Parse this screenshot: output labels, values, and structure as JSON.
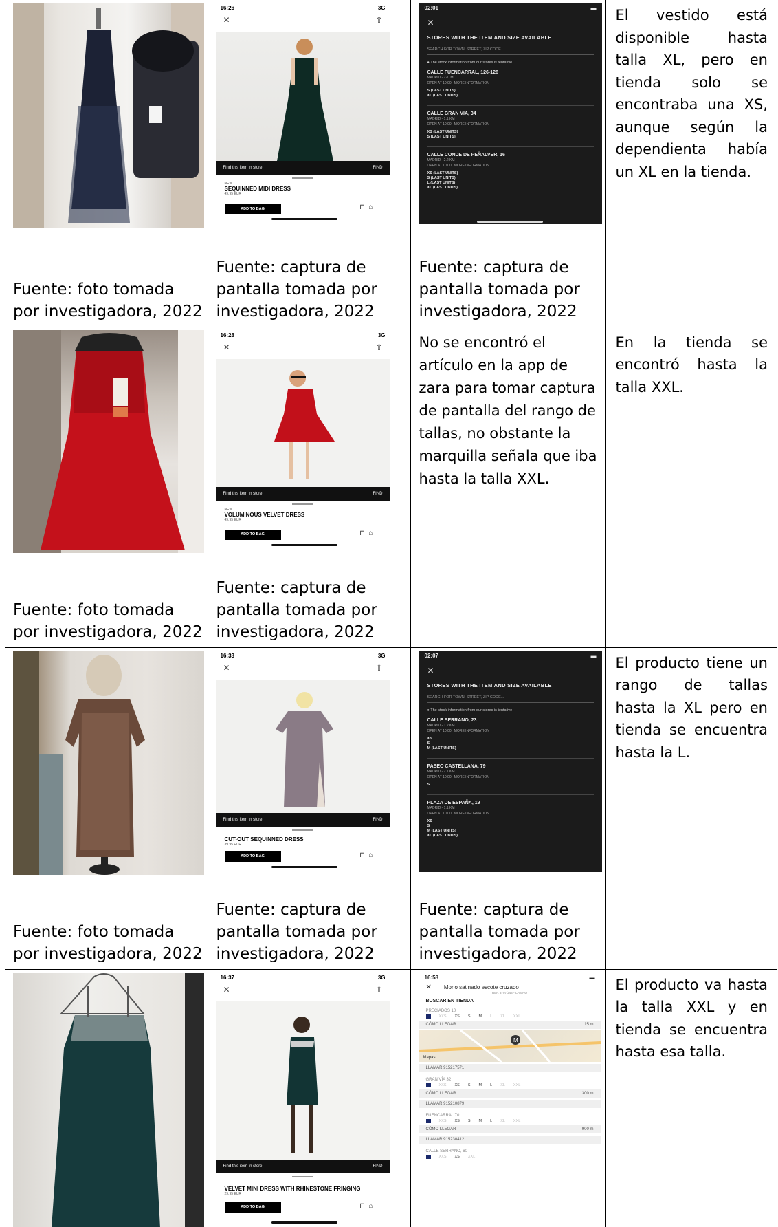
{
  "captions": {
    "photo": "Fuente: foto tomada por investigadora, 2022",
    "screenshot": "Fuente: captura de pantalla tomada por investigadora, 2022"
  },
  "rows": [
    {
      "note": "El vestido está disponible hasta talla XL, pero en tienda solo se encontraba una XS, aunque según la dependienta había un XL en la tienda.",
      "app": {
        "time": "16:26",
        "signal": "3G",
        "new_label": "NEW",
        "name": "SEQUINNED MIDI DRESS",
        "price": "49.95 EUR",
        "find_label": "Find this item in store",
        "find_action": "FIND",
        "add_label": "ADD TO BAG"
      },
      "stores_screen": {
        "time": "02:01",
        "title": "STORES WITH THE ITEM AND SIZE AVAILABLE",
        "search_placeholder": "SEARCH FOR TOWN, STREET, ZIP CODE...",
        "info": "The stock information from our stores is tentative",
        "stores": [
          {
            "name": "CALLE FUENCARRAL, 126-128",
            "city": "MADRID - 220 M",
            "open": "OPEN AT 10:00",
            "more": "MORE INFORMATION",
            "sizes": [
              "S (LAST UNITS)",
              "XL (LAST UNITS)"
            ]
          },
          {
            "name": "CALLE GRAN VIA, 34",
            "city": "MADRID - 1.1 KM",
            "open": "OPEN AT 10:00",
            "more": "MORE INFORMATION",
            "sizes": [
              "XS (LAST UNITS)",
              "S (LAST UNITS)"
            ]
          },
          {
            "name": "CALLE CONDE DE PEÑALVER, 16",
            "city": "MADRID - 2.2 KM",
            "open": "OPEN AT 10:00",
            "more": "MORE INFORMATION",
            "sizes": [
              "XS (LAST UNITS)",
              "S (LAST UNITS)",
              "L (LAST UNITS)",
              "XL (LAST UNITS)"
            ]
          }
        ]
      }
    },
    {
      "note": "En la tienda se encontró hasta la talla XXL.",
      "middle_note": "No se encontró el artículo en la app de zara para tomar captura de pantalla del rango de tallas, no obstante la marquilla señala que iba hasta la talla XXL.",
      "app": {
        "time": "16:28",
        "signal": "3G",
        "new_label": "NEW",
        "name": "VOLUMINOUS VELVET DRESS",
        "price": "49.95 EUR",
        "find_label": "Find this item in store",
        "find_action": "FIND",
        "add_label": "ADD TO BAG"
      }
    },
    {
      "note": "El producto tiene un rango de tallas hasta la XL pero en tienda se encuentra hasta la L.",
      "app": {
        "time": "16:33",
        "signal": "3G",
        "name": "CUT-OUT SEQUINNED DRESS",
        "price": "39.95 EUR",
        "find_label": "Find this item in store",
        "find_action": "FIND",
        "add_label": "ADD TO BAG"
      },
      "stores_screen": {
        "time": "02:07",
        "title": "STORES WITH THE ITEM AND SIZE AVAILABLE",
        "search_placeholder": "SEARCH FOR TOWN, STREET, ZIP CODE...",
        "info": "The stock information from our stores is tentative",
        "stores": [
          {
            "name": "CALLE SERRANO, 23",
            "city": "MADRID - 1.2 KM",
            "open": "OPEN AT 10:00",
            "more": "MORE INFORMATION",
            "sizes": [
              "XS",
              "S",
              "M (LAST UNITS)"
            ]
          },
          {
            "name": "PASEO CASTELLANA, 79",
            "city": "MADRID - 2.1 KM",
            "open": "OPEN AT 10:00",
            "more": "MORE INFORMATION",
            "sizes": [
              "S"
            ]
          },
          {
            "name": "PLAZA DE ESPAÑA, 19",
            "city": "MADRID - 1.1 KM",
            "open": "OPEN AT 10:00",
            "more": "MORE INFORMATION",
            "sizes": [
              "XS",
              "S",
              "M (LAST UNITS)",
              "XL (LAST UNITS)"
            ]
          }
        ]
      }
    },
    {
      "note": "El producto va hasta la talla XXL y en tienda se encuentra hasta esa talla.",
      "app": {
        "time": "16:37",
        "signal": "3G",
        "name": "VELVET MINI DRESS WITH RHINESTONE FRINGING",
        "price": "29.95 EUR",
        "find_label": "Find this item in store",
        "find_action": "FIND",
        "add_label": "ADD TO BAG"
      },
      "es_screen": {
        "time": "16:58",
        "title": "Mono satinado escote cruzado",
        "ref": "REF. 3707/244 - CASINO",
        "search_title": "BUSCAR EN TIENDA",
        "map_label": "Mapas",
        "sizes": [
          "XXS",
          "XS",
          "S",
          "M",
          "L",
          "XL",
          "XXL"
        ],
        "how_label": "CÓMO LLEGAR",
        "stores": [
          {
            "name": "PRECIADOS 10",
            "distance": "15 m",
            "call": "LLAMAR 915217571"
          },
          {
            "name": "GRAN VÍA 32",
            "distance": "300 m",
            "call": "LLAMAR 915210879"
          },
          {
            "name": "FUENCARRAL 70",
            "distance": "900 m",
            "call": "LLAMAR 915230412"
          },
          {
            "name": "CALLE SERRANO, 60"
          }
        ]
      }
    }
  ]
}
